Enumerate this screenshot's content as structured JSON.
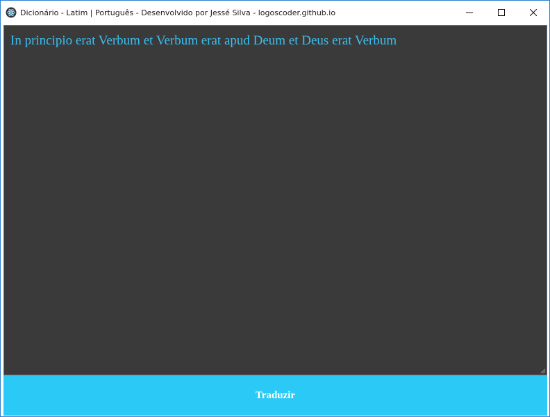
{
  "window": {
    "title": "Dicionário - Latim | Português - Desenvolvido por Jessé Silva - logoscoder.github.io",
    "app_icon": "electron-atom-icon",
    "controls": {
      "minimize_icon": "minimize-icon",
      "maximize_icon": "maximize-icon",
      "close_icon": "close-icon"
    }
  },
  "editor": {
    "value": "In principio erat Verbum et Verbum erat apud Deum et Deus erat Verbum",
    "text_color": "#3bbff0",
    "background": "#3a3a3a"
  },
  "action": {
    "translate_label": "Traduzir",
    "color": "#2bc9f6"
  }
}
